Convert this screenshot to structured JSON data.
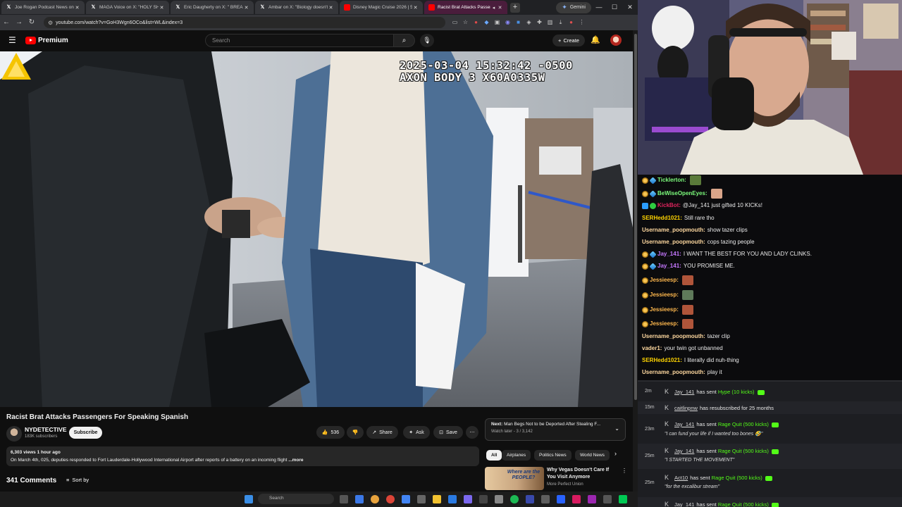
{
  "tabs": [
    {
      "title": "Joe Rogan Podcast News on X",
      "icon": "x-logo",
      "active": false
    },
    {
      "title": "MAGA Voice on X: \"HOLY SH",
      "icon": "x-logo",
      "active": false
    },
    {
      "title": "Eric Daugherty on X: \" BREAK",
      "icon": "x-logo",
      "active": false
    },
    {
      "title": "Ambar on X: \"Biology doesn't c",
      "icon": "x-logo",
      "active": false
    },
    {
      "title": "Disney Magic Cruise 2026 | 5-N",
      "icon": "youtube-logo",
      "active": false
    },
    {
      "title": "Racist Brat Attacks Passeng",
      "icon": "youtube-logo",
      "active": true
    }
  ],
  "gemini_label": "Gemini",
  "url": "youtube.com/watch?v=GoH3Wgn6OCo&list=WL&index=3",
  "youtube": {
    "logo_label": "Premium",
    "search_placeholder": "Search",
    "create_label": "Create"
  },
  "video": {
    "timestamp_line1": "2025-03-04 15:32:42 -0500",
    "timestamp_line2": "AXON BODY 3 X60A0335W",
    "title": "Racist Brat Attacks Passengers For Speaking Spanish",
    "channel": "NYDETECTIVE",
    "subscribers": "183K subscribers",
    "subscribe_label": "Subscribe",
    "likes": "536",
    "share_label": "Share",
    "ask_label": "Ask",
    "save_label": "Save",
    "views_time": "6,303 views  1 hour ago",
    "description": "On March 4th, 025, deputies responded to Fort Lauderdale-Hollywood International Airport after reports of a battery on an incoming flight",
    "more_label": "...more",
    "comments_count": "341 Comments",
    "sort_label": "Sort by"
  },
  "up_next": {
    "prefix": "Next:",
    "title": "Man Begs Not to be Deported After Stealing F...",
    "sub": "Watch later - 3 / 3,142"
  },
  "chips": [
    "All",
    "Airplanes",
    "Politics News",
    "World News"
  ],
  "recommendation": {
    "thumb_text": "Where are the PEOPLE?",
    "title": "Why Vegas Doesn't Care If You Visit Anymore",
    "channel": "More Perfect Union"
  },
  "taskbar": {
    "search_placeholder": "Search"
  },
  "chat": [
    {
      "user": "Ticklerton:",
      "text": "",
      "color": "#7CFC7C",
      "badges": [
        "coin",
        "blue"
      ],
      "emote": true
    },
    {
      "user": "BeWiseOpenEyes:",
      "text": "",
      "color": "#7CFC7C",
      "badges": [
        "coin",
        "blue"
      ],
      "emote": true
    },
    {
      "user": "KickBot:",
      "text": "@Jay_141 just gifted 10 KICKs!",
      "color": "#e0245e",
      "badges": [
        "kick",
        "green"
      ],
      "emote": false
    },
    {
      "user": "SERHedd1021:",
      "text": "Still rare tho",
      "color": "#ffd400",
      "badges": [],
      "emote": false
    },
    {
      "user": "Username_poopmouth:",
      "text": "show tazer clips",
      "color": "#ffd9a0",
      "badges": [],
      "emote": false
    },
    {
      "user": "Username_poopmouth:",
      "text": "cops tazing people",
      "color": "#ffd9a0",
      "badges": [],
      "emote": false
    },
    {
      "user": "Jay_141:",
      "text": "I WANT THE BEST FOR YOU AND LADY CLINKS.",
      "color": "#c678ff",
      "badges": [
        "coin",
        "blue"
      ],
      "emote": false
    },
    {
      "user": "Jay_141:",
      "text": "YOU PROMISE ME.",
      "color": "#c678ff",
      "badges": [
        "coin",
        "blue"
      ],
      "emote": false
    },
    {
      "user": "Jessieesp:",
      "text": "",
      "color": "#ffb84d",
      "badges": [
        "coin"
      ],
      "emote": true
    },
    {
      "user": "Jessieesp:",
      "text": "",
      "color": "#ffb84d",
      "badges": [
        "coin"
      ],
      "emote": true
    },
    {
      "user": "Jessieesp:",
      "text": "",
      "color": "#ffb84d",
      "badges": [
        "coin"
      ],
      "emote": true
    },
    {
      "user": "Jessieesp:",
      "text": "",
      "color": "#ffb84d",
      "badges": [
        "coin"
      ],
      "emote": true
    },
    {
      "user": "Username_poopmouth:",
      "text": "tazer clip",
      "color": "#ffd9a0",
      "badges": [],
      "emote": false
    },
    {
      "user": "vader1:",
      "text": "your twin got unbanned",
      "color": "#ffd9a0",
      "badges": [],
      "emote": false
    },
    {
      "user": "SERHedd1021:",
      "text": "I literally did nuh-thing",
      "color": "#ffd400",
      "badges": [],
      "emote": false
    },
    {
      "user": "Username_poopmouth:",
      "text": "play it",
      "color": "#ffd9a0",
      "badges": [],
      "emote": false
    }
  ],
  "events": [
    {
      "time": "2m",
      "user": "Jay_141",
      "action": "has sent",
      "highlight": "Hype (10 kicks)",
      "quote": ""
    },
    {
      "time": "15m",
      "user": "caitlinpnw",
      "action": "has resubscribed for 25 months",
      "highlight": "",
      "quote": ""
    },
    {
      "time": "23m",
      "user": "Jay_141",
      "action": "has sent",
      "highlight": "Rage Quit (500 kicks)",
      "quote": "\"I can fund your life if I wanted too bones 🤣\""
    },
    {
      "time": "25m",
      "user": "Jay_141",
      "action": "has sent",
      "highlight": "Rage Quit (500 kicks)",
      "quote": "\"I STARTED THE MOVEMENT\""
    },
    {
      "time": "25m",
      "user": "Act10",
      "action": "has sent",
      "highlight": "Rage Quit (500 kicks)",
      "quote": "\"for the excalibur stream\""
    },
    {
      "time": "",
      "user": "Jay_141",
      "action": "has sent",
      "highlight": "Rage Quit (500 kicks)",
      "quote": ""
    }
  ]
}
